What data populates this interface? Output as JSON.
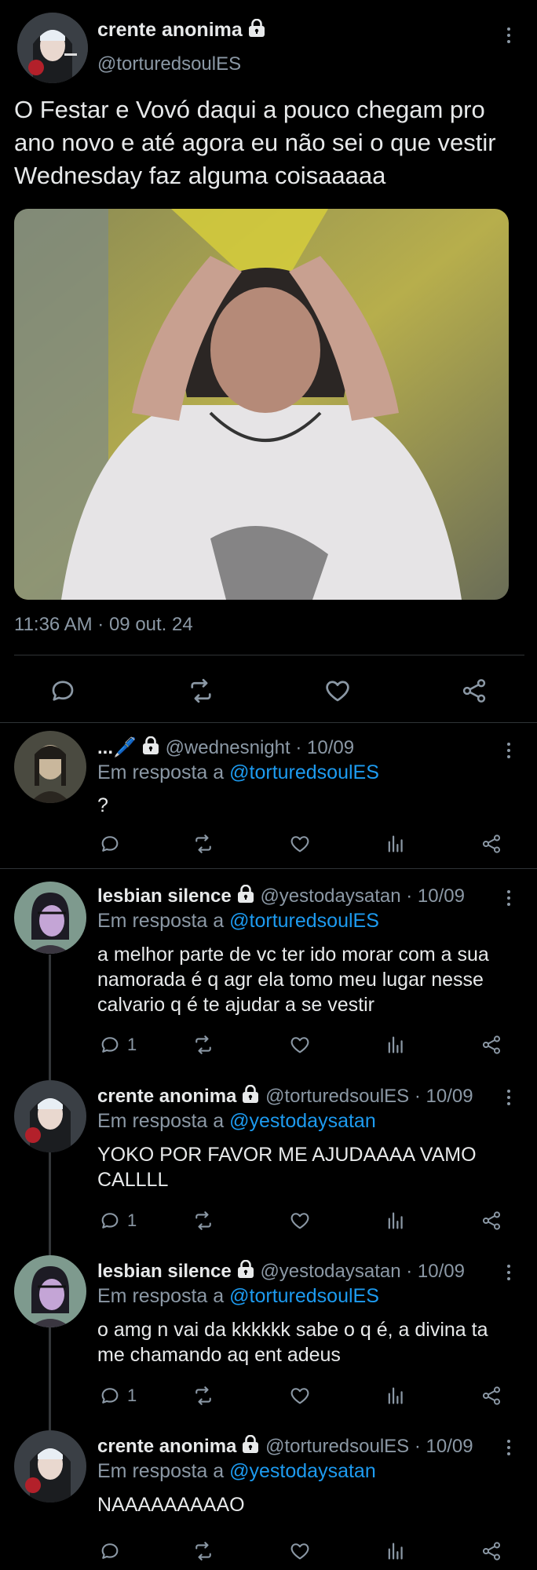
{
  "main_tweet": {
    "name": "crente anonima",
    "handle": "@torturedsoulES",
    "text": "O Festar e Vovó daqui a pouco chegam pro ano novo e até agora eu não sei o que vestir Wednesday faz alguma coisaaaaa",
    "timestamp": "11:36 AM · 09 out. 24",
    "icons": [
      "reply-icon",
      "retweet-icon",
      "like-icon",
      "share-icon"
    ]
  },
  "replies": [
    {
      "name": "...🖊️",
      "handle_meta": "@wednesnight · 10/09",
      "reply_prefix": "Em resposta a",
      "reply_to": "@torturedsoulES",
      "text": "?",
      "reply_count": ""
    },
    {
      "name": "lesbian silence",
      "handle_meta": "@yestodaysatan · 10/09",
      "reply_prefix": "Em resposta a",
      "reply_to": "@torturedsoulES",
      "text": "a melhor parte de vc ter ido morar com a sua namorada é q agr ela tomo meu lugar nesse calvario q é te ajudar a se vestir",
      "reply_count": "1"
    },
    {
      "name": "crente anonima",
      "handle_meta": "@torturedsoulES · 10/09",
      "reply_prefix": "Em resposta a",
      "reply_to": "@yestodaysatan",
      "text": "YOKO POR FAVOR ME AJUDAAAA VAMO CALLLL",
      "reply_count": "1"
    },
    {
      "name": "lesbian silence",
      "handle_meta": "@yestodaysatan · 10/09",
      "reply_prefix": "Em resposta a",
      "reply_to": "@torturedsoulES",
      "text": "o amg n vai da kkkkkk sabe o q é, a divina ta me chamando aq ent adeus",
      "reply_count": "1"
    },
    {
      "name": "crente anonima",
      "handle_meta": "@torturedsoulES · 10/09",
      "reply_prefix": "Em resposta a",
      "reply_to": "@yestodaysatan",
      "text": "NAAAAAAAAAO",
      "reply_count": ""
    }
  ],
  "colors": {
    "background": "#000000",
    "text": "#e7e9ea",
    "muted": "#8b98a5",
    "link": "#1d9bf0",
    "separator": "#2f3336"
  }
}
